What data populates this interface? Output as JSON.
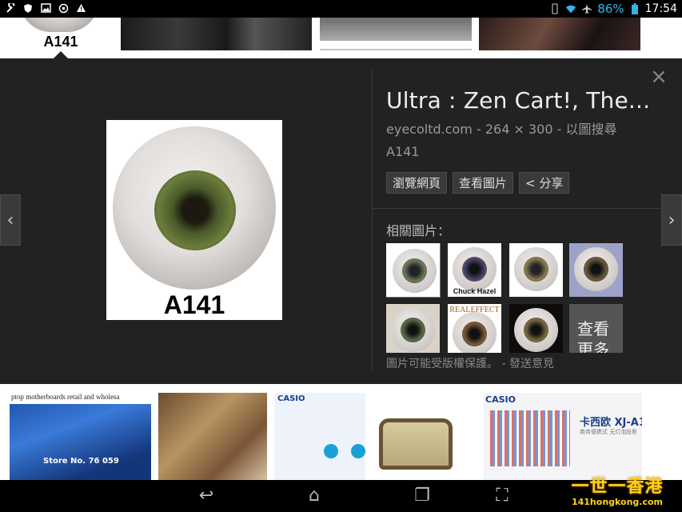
{
  "status_bar": {
    "battery_percent": "86%",
    "time": "17:54",
    "left_icons": [
      "wrench-icon",
      "shield-icon",
      "image-icon",
      "sync-icon",
      "warning-icon"
    ],
    "right_icons": [
      "vibrate-icon",
      "wifi-icon",
      "airplane-icon",
      "battery-icon"
    ]
  },
  "top_strip": {
    "selected_thumb_label": "A141"
  },
  "detail": {
    "preview_label": "A141",
    "title": "Ultra : Zen Cart!, The...",
    "source": "eyecoltd.com",
    "separator": "-",
    "dimensions": "264 × 300",
    "search_by_image": "以圖搜尋",
    "filename": "A141",
    "buttons": {
      "visit_page": "瀏覽網頁",
      "view_image": "查看圖片",
      "share": "< 分享"
    },
    "related_label": "相關圖片：",
    "related": [
      {
        "caption": ""
      },
      {
        "caption": "Chuck Hazel"
      },
      {
        "caption": ""
      },
      {
        "caption": ""
      },
      {
        "caption": ""
      },
      {
        "caption": "REALEFFECT"
      },
      {
        "caption": ""
      },
      {
        "caption": "查看更多"
      }
    ],
    "copyright_notice": "圖片可能受版權保護。",
    "feedback": "- 發送意見",
    "close_glyph": "×",
    "prev_glyph": "‹",
    "next_glyph": "›"
  },
  "bottom_strip": {
    "thumb1_header": "ptop motherboards retail and wholesa",
    "thumb1_text": "Store No. 76 059",
    "thumb3_brand": "CASIO",
    "thumb5_brand": "CASIO",
    "thumb5_title": "卡西欧 XJ-A1",
    "thumb5_sub": "商务便携式 无灯泡投影"
  },
  "nav_bar": {
    "back_glyph": "↩",
    "home_glyph": "⌂",
    "recent_glyph": "❐",
    "screenshot_glyph": "⛶"
  },
  "watermark": {
    "line1": "一世一香港",
    "line2": "141hongkong.com"
  }
}
